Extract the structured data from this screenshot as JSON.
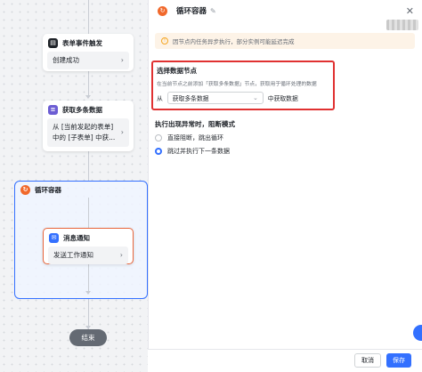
{
  "canvas": {
    "trigger_node": {
      "title": "表单事件触发",
      "body": "创建成功"
    },
    "fetch_node": {
      "title": "获取多条数据",
      "body_line1": "从 [当前发起的表单]",
      "body_line2": "中的 [子表单] 中获..."
    },
    "loop_node": {
      "title": "循环容器"
    },
    "notify_node": {
      "title": "消息通知",
      "body": "发送工作通知"
    },
    "end_label": "结束"
  },
  "panel": {
    "title": "循环容器",
    "notice": "因节点内任务异步执行，部分实例可能延迟完成",
    "select_section": {
      "title": "选择数据节点",
      "desc": "在当前节点之前添加「获取多条数据」节点，获取用于循环处理的数据",
      "prefix": "从",
      "selected": "获取多条数据",
      "suffix": "中获取数据"
    },
    "error_section": {
      "title": "执行出现异常时，阻断模式",
      "options": [
        "直接阻断，跳出循环",
        "跳过并执行下一条数据"
      ],
      "selected_index": 1
    },
    "footer": {
      "cancel": "取消",
      "save": "保存"
    }
  },
  "colors": {
    "accent": "#3370ff",
    "highlight": "#e03131",
    "loop_orange": "#f1692c",
    "warning_bg": "#fdf3e7"
  }
}
